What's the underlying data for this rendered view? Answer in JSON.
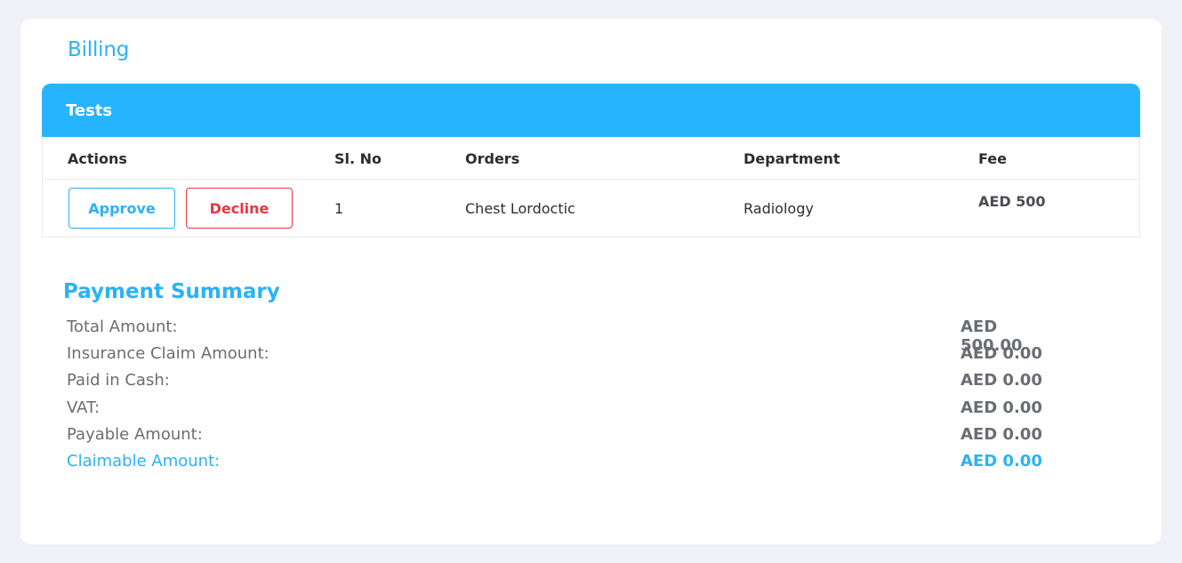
{
  "page": {
    "title": "Billing"
  },
  "tests": {
    "header": "Tests",
    "columns": {
      "actions": "Actions",
      "sl_no": "Sl. No",
      "orders": "Orders",
      "department": "Department",
      "fee": "Fee"
    },
    "rows": [
      {
        "approve_label": "Approve",
        "decline_label": "Decline",
        "sl_no": "1",
        "order": "Chest Lordoctic",
        "department": "Radiology",
        "fee": "AED 500"
      }
    ]
  },
  "summary": {
    "title": "Payment Summary",
    "items": [
      {
        "label": "Total Amount:",
        "value": "AED 500.00"
      },
      {
        "label": "Insurance Claim Amount:",
        "value": "AED 0.00"
      },
      {
        "label": "Paid in Cash:",
        "value": "AED 0.00"
      },
      {
        "label": "VAT:",
        "value": "AED 0.00"
      },
      {
        "label": "Payable Amount:",
        "value": "AED 0.00"
      },
      {
        "label": "Claimable Amount:",
        "value": "AED 0.00"
      }
    ]
  },
  "colors": {
    "accent": "#27b4fe",
    "decline": "#e8373e",
    "background": "#f0f1f6"
  }
}
